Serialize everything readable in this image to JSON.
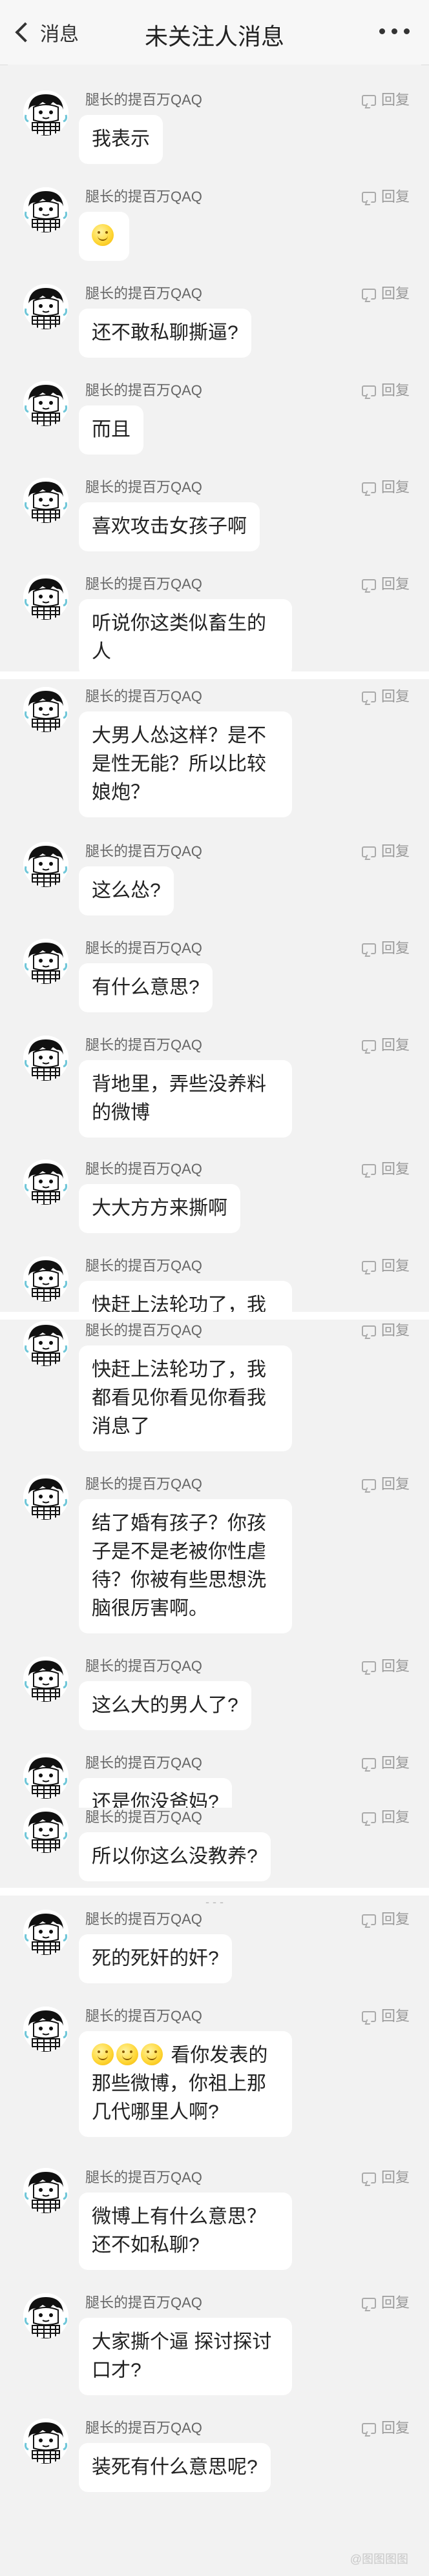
{
  "header": {
    "back_label": "消息",
    "title": "未关注人消息",
    "more_icon": "more-dots-icon"
  },
  "common": {
    "username": "腿长的提百万QAQ",
    "reply_label": "回复"
  },
  "messages": [
    "我表示",
    "",
    "还不敢私聊撕逼?",
    "而且",
    "喜欢攻击女孩子啊",
    "听说你这类似畜生的人",
    "大男人怂这样？是不是性无能？所以比较娘炮？",
    "这么怂?",
    "有什么意思?",
    "背地里，弄些没养料的微博",
    "大大方方来撕啊",
    "快赶上法轮功了，我都",
    "快赶上法轮功了，我都看见你看见你看我消息了",
    "结了婚有孩子？你孩子是不是老被你性虐待？你被有些思想洗脑很厉害啊。",
    "这么大的男人了?",
    "还是你没爸妈?",
    "所以你这么没教养?",
    "死的死奸的奸?",
    "看你发表的那些微博，你祖上那几代哪里人啊?",
    "微博上有什么意思？还不如私聊?",
    "大家撕个逼 探讨探讨口才?",
    "装死有什么意思呢?"
  ],
  "emoji": {
    "name": "smile-emoji"
  },
  "timestamp_partial": "- - -",
  "watermark": "@图图图图"
}
